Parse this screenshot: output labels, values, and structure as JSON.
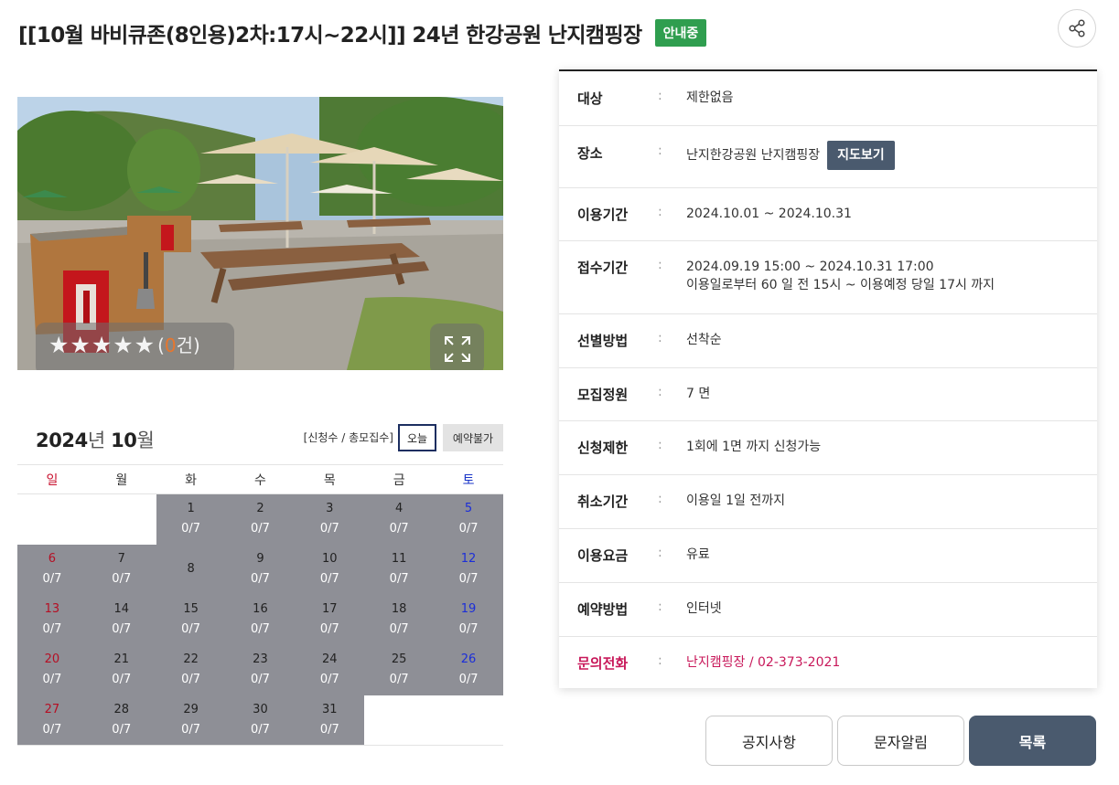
{
  "header": {
    "title": "[[10월 바비큐존(8인용)2차:17시~22시]] 24년 한강공원 난지캠핑장",
    "status_badge": "안내중",
    "share_icon": "share-icon"
  },
  "photo": {
    "stars": "★★★★★",
    "rating_open": "(",
    "rating_number": "0",
    "rating_suffix": "건)",
    "rating_value": 0,
    "rating_max": 5,
    "expand_icon": "expand-icon"
  },
  "calendar": {
    "year": "2024",
    "year_unit": "년",
    "month": "10",
    "month_unit": "월",
    "legend": "[신청수 / 총모집수]",
    "today_label": "오늘",
    "unavailable_label": "예약불가",
    "weekdays": [
      "일",
      "월",
      "화",
      "수",
      "목",
      "금",
      "토"
    ],
    "weeks": [
      [
        null,
        null,
        {
          "day": "1",
          "count": "0/7"
        },
        {
          "day": "2",
          "count": "0/7"
        },
        {
          "day": "3",
          "count": "0/7"
        },
        {
          "day": "4",
          "count": "0/7"
        },
        {
          "day": "5",
          "count": "0/7"
        }
      ],
      [
        {
          "day": "6",
          "count": "0/7"
        },
        {
          "day": "7",
          "count": "0/7"
        },
        {
          "day": "8",
          "count": ""
        },
        {
          "day": "9",
          "count": "0/7"
        },
        {
          "day": "10",
          "count": "0/7"
        },
        {
          "day": "11",
          "count": "0/7"
        },
        {
          "day": "12",
          "count": "0/7"
        }
      ],
      [
        {
          "day": "13",
          "count": "0/7"
        },
        {
          "day": "14",
          "count": "0/7"
        },
        {
          "day": "15",
          "count": "0/7"
        },
        {
          "day": "16",
          "count": "0/7"
        },
        {
          "day": "17",
          "count": "0/7"
        },
        {
          "day": "18",
          "count": "0/7"
        },
        {
          "day": "19",
          "count": "0/7"
        }
      ],
      [
        {
          "day": "20",
          "count": "0/7"
        },
        {
          "day": "21",
          "count": "0/7"
        },
        {
          "day": "22",
          "count": "0/7"
        },
        {
          "day": "23",
          "count": "0/7"
        },
        {
          "day": "24",
          "count": "0/7"
        },
        {
          "day": "25",
          "count": "0/7"
        },
        {
          "day": "26",
          "count": "0/7"
        }
      ],
      [
        {
          "day": "27",
          "count": "0/7"
        },
        {
          "day": "28",
          "count": "0/7"
        },
        {
          "day": "29",
          "count": "0/7"
        },
        {
          "day": "30",
          "count": "0/7"
        },
        {
          "day": "31",
          "count": "0/7"
        },
        null,
        null
      ]
    ]
  },
  "info": {
    "colon": ":",
    "target_label": "대상",
    "target_value": "제한없음",
    "place_label": "장소",
    "place_value": "난지한강공원 난지캠핑장",
    "map_button": "지도보기",
    "period_label": "이용기간",
    "period_value": "2024.10.01 ~ 2024.10.31",
    "reception_label": "접수기간",
    "reception_value_1": "2024.09.19 15:00 ~ 2024.10.31 17:00",
    "reception_value_2": "이용일로부터 60 일 전 15시 ~ 이용예정 당일 17시 까지",
    "selection_label": "선별방법",
    "selection_value": "선착순",
    "capacity_label": "모집정원",
    "capacity_value": "7 면",
    "limit_label": "신청제한",
    "limit_value": "1회에 1면 까지 신청가능",
    "cancel_label": "취소기간",
    "cancel_value": "이용일 1일 전까지",
    "fee_label": "이용요금",
    "fee_value": "유료",
    "method_label": "예약방법",
    "method_value": "인터넷",
    "contact_label": "문의전화",
    "contact_value": "난지캠핑장 / 02-373-2021"
  },
  "buttons": {
    "notice": "공지사항",
    "sms": "문자알림",
    "list": "목록"
  },
  "colors": {
    "status_green": "#2f9e4f",
    "button_slate": "#4a5a6e",
    "calendar_cell": "#8e8f96",
    "sunday_red": "#c8102e",
    "saturday_blue": "#1a35c8",
    "contact_pink": "#c8185a"
  }
}
